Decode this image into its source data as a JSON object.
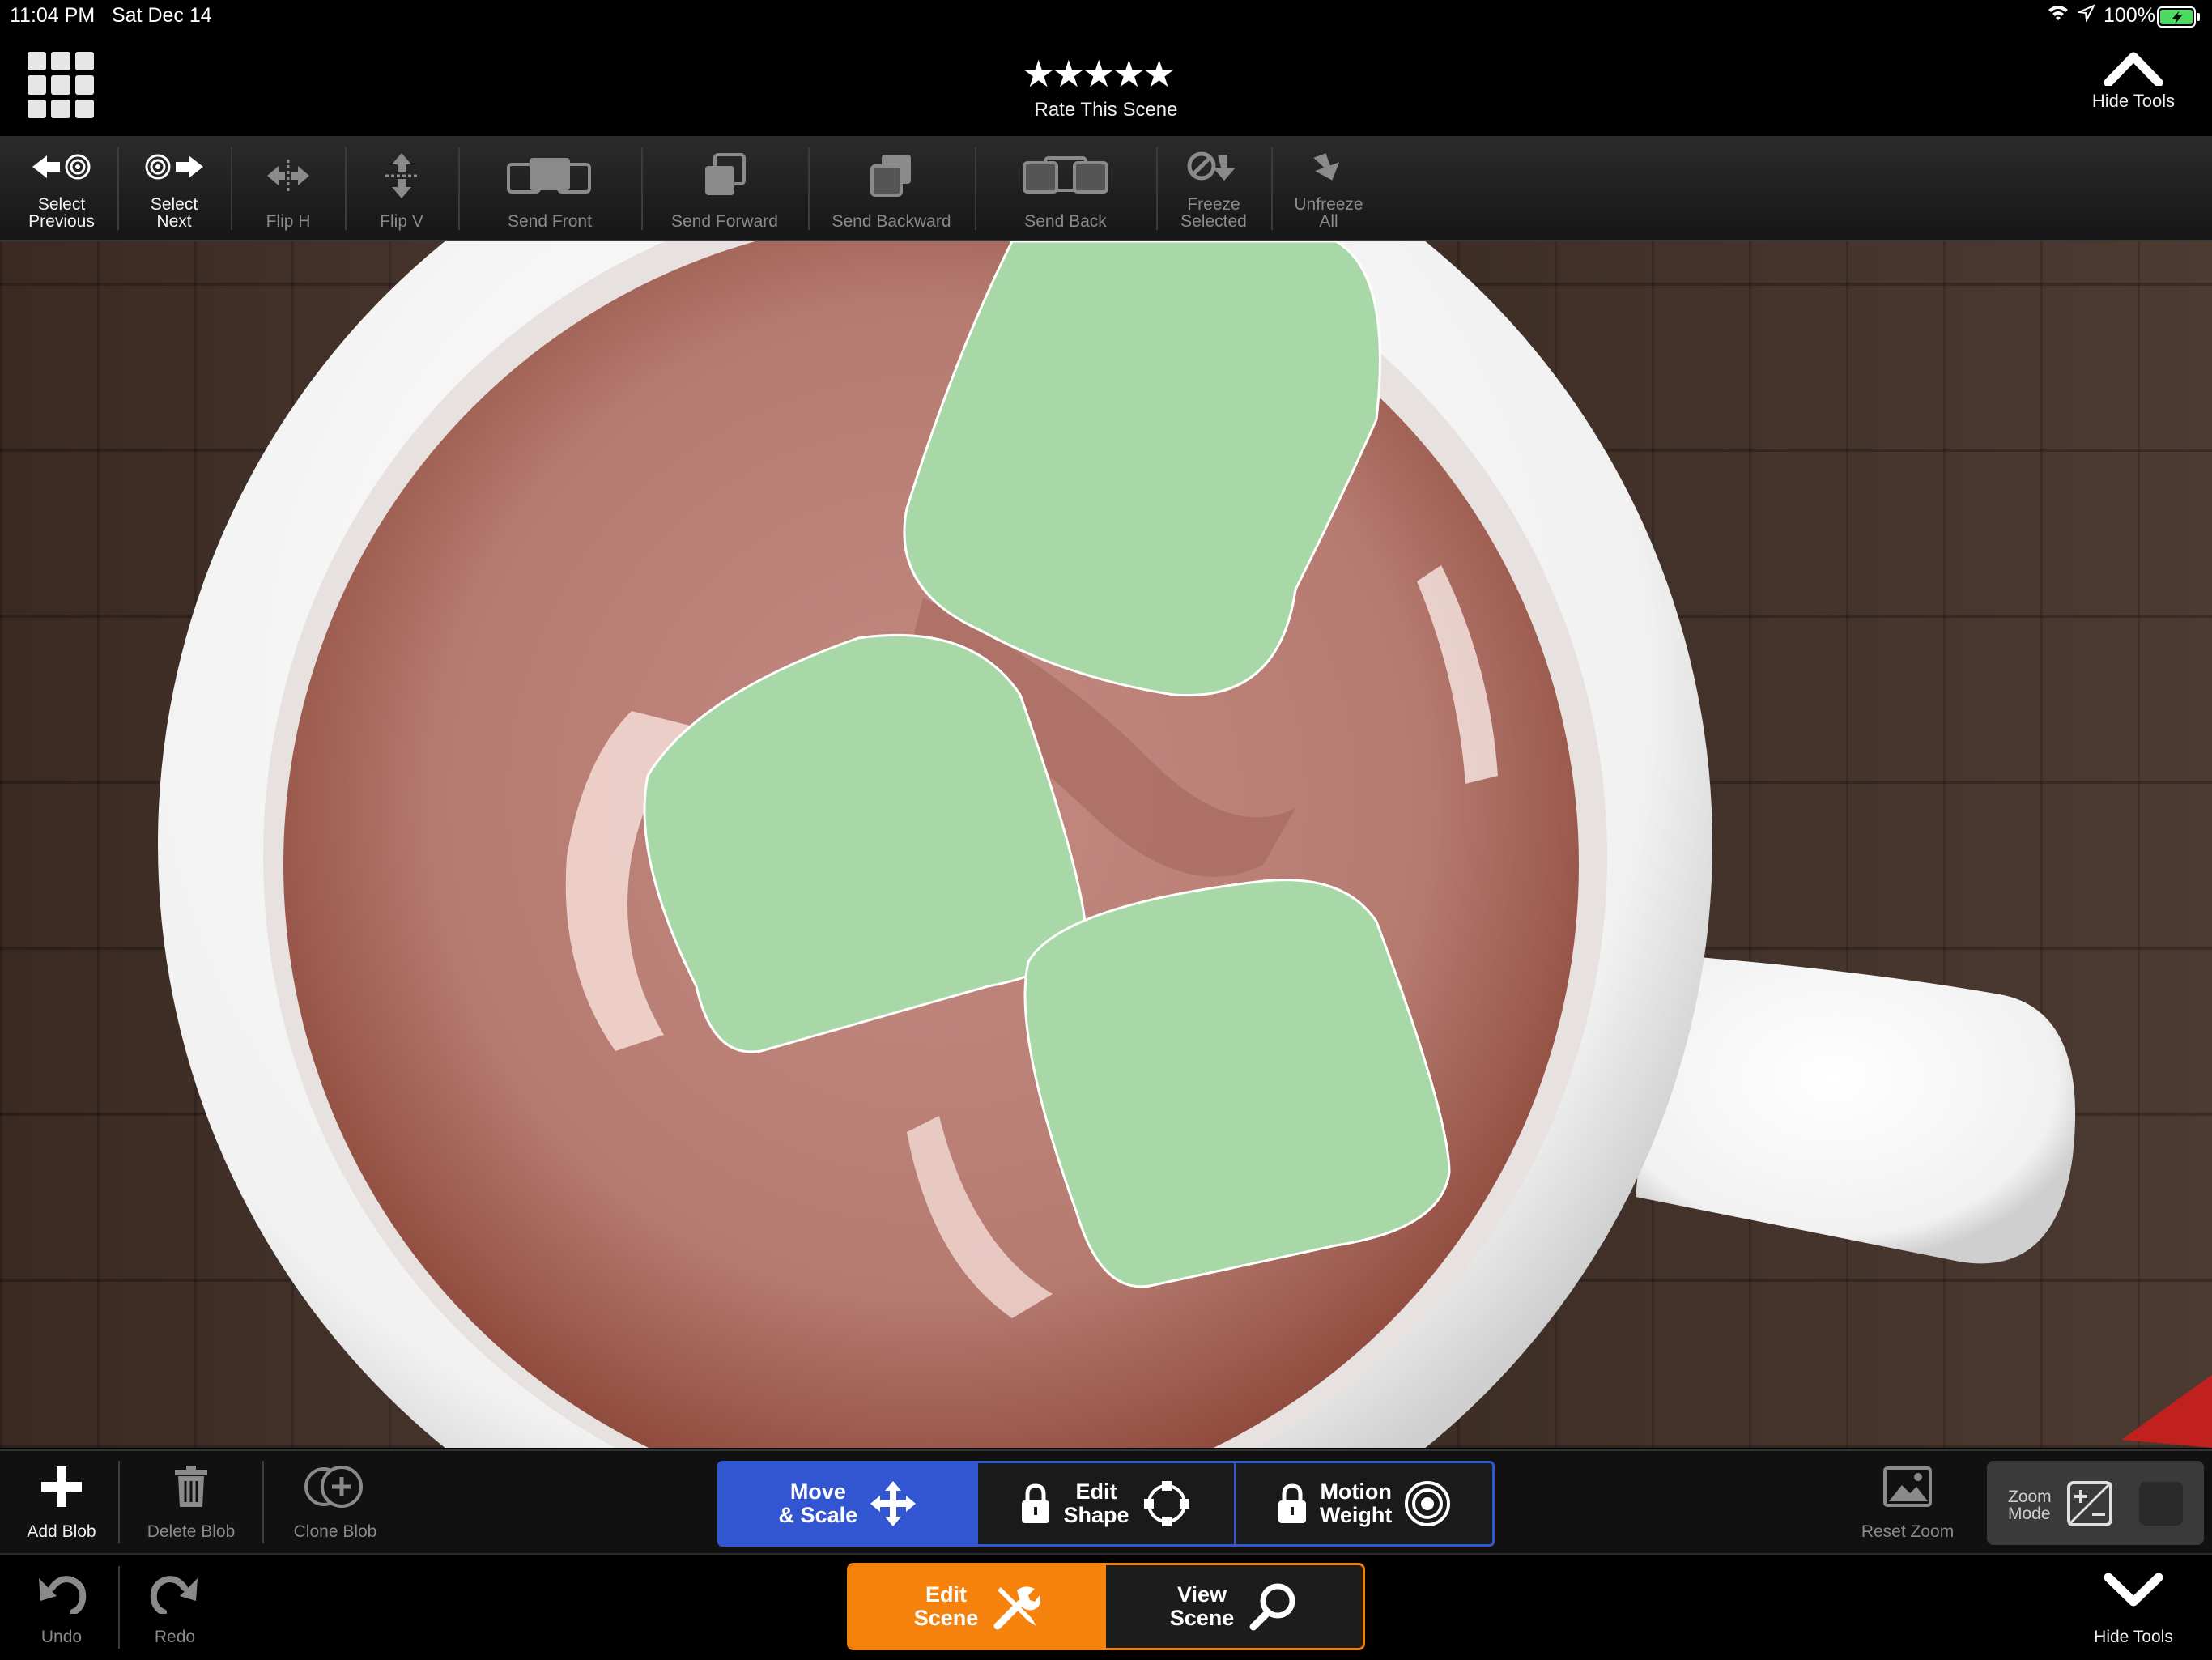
{
  "status_bar": {
    "time": "11:04 PM",
    "date": "Sat Dec 14",
    "battery": "100%"
  },
  "header": {
    "stars": "★★★★★",
    "rate_label": "Rate This Scene",
    "hide_tools": "Hide Tools"
  },
  "toolbar": {
    "select_previous": [
      "Select",
      "Previous"
    ],
    "select_next": [
      "Select",
      "Next"
    ],
    "flip_h": "Flip H",
    "flip_v": "Flip V",
    "send_front": "Send Front",
    "send_forward": "Send Forward",
    "send_backward": "Send Backward",
    "send_back": "Send Back",
    "freeze_selected": [
      "Freeze",
      "Selected"
    ],
    "unfreeze_all": [
      "Unfreeze",
      "All"
    ]
  },
  "tools": {
    "add_blob": "Add Blob",
    "delete_blob": "Delete Blob",
    "clone_blob": "Clone Blob",
    "reset_zoom": "Reset Zoom",
    "zoom_mode": [
      "Zoom",
      "Mode"
    ]
  },
  "modes": {
    "move_scale": [
      "Move",
      "& Scale"
    ],
    "edit_shape": [
      "Edit",
      "Shape"
    ],
    "motion_weight": [
      "Motion",
      "Weight"
    ]
  },
  "nav": {
    "undo": "Undo",
    "redo": "Redo",
    "edit_scene": [
      "Edit",
      "Scene"
    ],
    "view_scene": [
      "View",
      "Scene"
    ],
    "hide_tools": "Hide Tools"
  },
  "colors": {
    "mode_accent": "#3256d2",
    "scene_accent": "#f5820d",
    "blob_fill": "#a8d8a8",
    "cocoa": "#b98278"
  }
}
